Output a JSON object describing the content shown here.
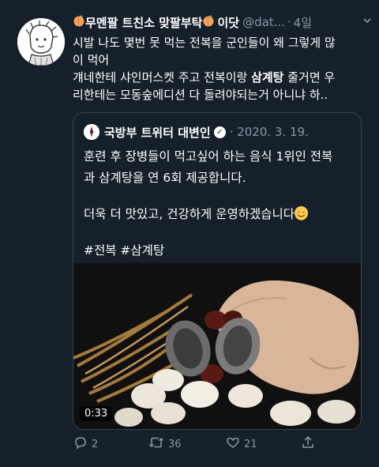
{
  "tweet": {
    "display_name": "무멘팔 트친소 맞팔부탁",
    "name_suffix": "이닷",
    "handle": "@dat...",
    "separator": "·",
    "time": "4일",
    "more": "⌄",
    "lines": [
      "시발 나도 몇번 못 먹는 전복을 군인들이 왜 그렇게 많",
      "이 먹어"
    ],
    "line3_before": "걔네한테 샤인머스켓 주고 전복이랑 ",
    "line3_bold": "삼계탕",
    "line3_after": " 줄거면 우",
    "line4": "리한테는 모동숲에디션 다 돌려야되는거 아니냐 하.."
  },
  "quote": {
    "name": "국방부 트위터 대변인",
    "verified": "✓",
    "date": "· 2020. 3. 19.",
    "text_line1": "훈련 후 장병들이 먹고싶어 하는 음식 1위인 전복",
    "text_line2": "과 삼계탕을 연 6회 제공합니다.",
    "text_line3": "더욱 더 맛있고, 건강하게 운영하겠습니다",
    "hashtags": "#전복 #삼계탕",
    "video_duration": "0:33"
  },
  "actions": {
    "reply_count": "2",
    "retweet_count": "36",
    "like_count": "21"
  },
  "colors": {
    "background": "#15202b",
    "secondary_text": "#8899a6",
    "border": "#38444d"
  }
}
